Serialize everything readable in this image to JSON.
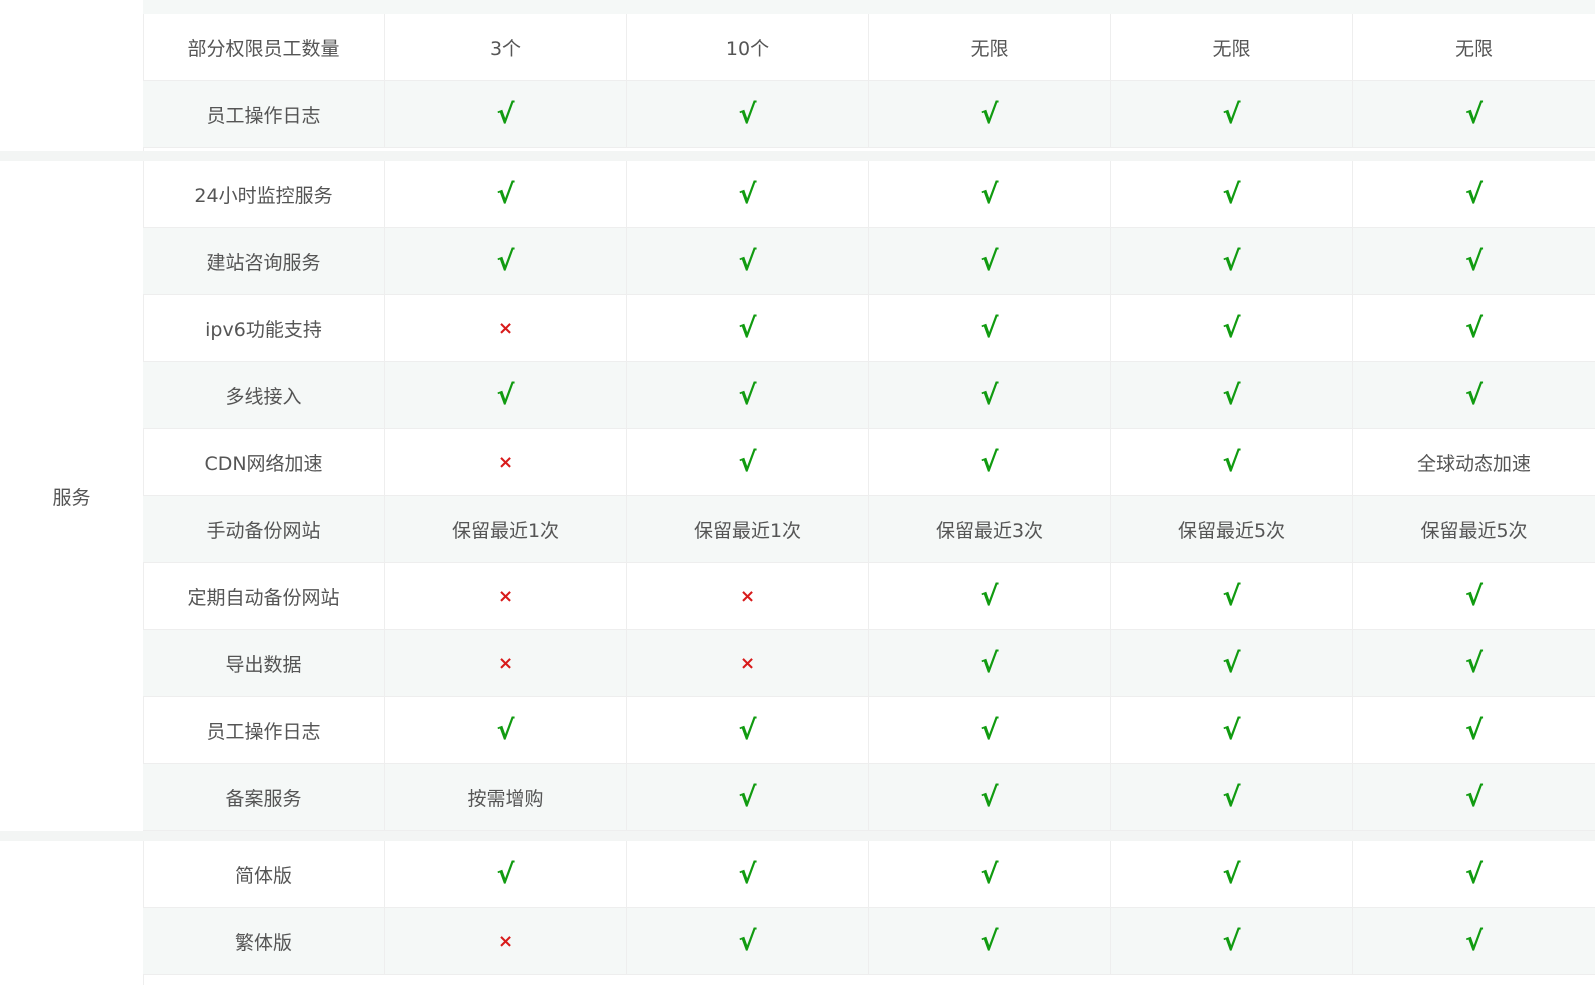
{
  "colors": {
    "check": "#119b11",
    "cross": "#d81b1b",
    "row_alt": "#f5f8f7",
    "separator": "#f3f5f4"
  },
  "icons": {
    "check": "√",
    "cross": "×"
  },
  "groups": [
    {
      "label": "",
      "rows": [
        {
          "feature": "部分权限员工数量",
          "values": [
            "3个",
            "10个",
            "无限",
            "无限",
            "无限"
          ]
        },
        {
          "feature": "员工操作日志",
          "values": [
            "√",
            "√",
            "√",
            "√",
            "√"
          ]
        }
      ]
    },
    {
      "label": "服务",
      "rows": [
        {
          "feature": "24小时监控服务",
          "values": [
            "√",
            "√",
            "√",
            "√",
            "√"
          ]
        },
        {
          "feature": "建站咨询服务",
          "values": [
            "√",
            "√",
            "√",
            "√",
            "√"
          ]
        },
        {
          "feature": "ipv6功能支持",
          "values": [
            "×",
            "√",
            "√",
            "√",
            "√"
          ]
        },
        {
          "feature": "多线接入",
          "values": [
            "√",
            "√",
            "√",
            "√",
            "√"
          ]
        },
        {
          "feature": "CDN网络加速",
          "values": [
            "×",
            "√",
            "√",
            "√",
            "全球动态加速"
          ]
        },
        {
          "feature": "手动备份网站",
          "values": [
            "保留最近1次",
            "保留最近1次",
            "保留最近3次",
            "保留最近5次",
            "保留最近5次"
          ]
        },
        {
          "feature": "定期自动备份网站",
          "values": [
            "×",
            "×",
            "√",
            "√",
            "√"
          ]
        },
        {
          "feature": "导出数据",
          "values": [
            "×",
            "×",
            "√",
            "√",
            "√"
          ]
        },
        {
          "feature": "员工操作日志",
          "values": [
            "√",
            "√",
            "√",
            "√",
            "√"
          ]
        },
        {
          "feature": "备案服务",
          "values": [
            "按需增购",
            "√",
            "√",
            "√",
            "√"
          ]
        }
      ]
    },
    {
      "label": "",
      "rows": [
        {
          "feature": "简体版",
          "values": [
            "√",
            "√",
            "√",
            "√",
            "√"
          ]
        },
        {
          "feature": "繁体版",
          "values": [
            "×",
            "√",
            "√",
            "√",
            "√"
          ]
        }
      ]
    }
  ]
}
